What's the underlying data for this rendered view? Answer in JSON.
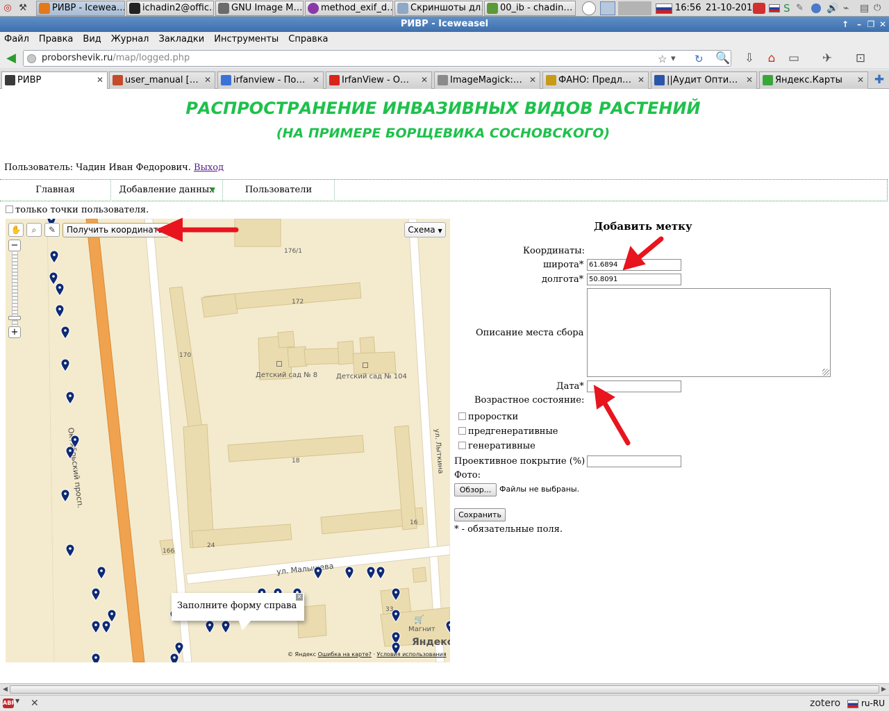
{
  "taskbar": {
    "tasks": [
      {
        "label": "РИВР - Icewea…",
        "active": true
      },
      {
        "label": "ichadin2@offic…"
      },
      {
        "label": "GNU Image M…"
      },
      {
        "label": "method_exif_d…"
      },
      {
        "label": "Скриншоты дл…"
      },
      {
        "label": "00_ib - chadin…"
      }
    ],
    "time": "16:56",
    "date": "21-10-2014"
  },
  "window": {
    "title": "РИВР - Iceweasel"
  },
  "menubar": {
    "items": [
      "Файл",
      "Правка",
      "Вид",
      "Журнал",
      "Закладки",
      "Инструменты",
      "Справка"
    ]
  },
  "navbar": {
    "url_host": "proborshevik.ru",
    "url_path": "/map/logged.php"
  },
  "tabs": [
    {
      "label": "РИВР",
      "active": true,
      "icon_color": "#3a3a3a"
    },
    {
      "label": "user_manual [Ин…",
      "icon_color": "#c44a2a"
    },
    {
      "label": "irfanview - Поиск…",
      "icon_color": "#3b72d9"
    },
    {
      "label": "IrfanView - Offici…",
      "icon_color": "#d8241a"
    },
    {
      "label": "ImageMagick: C…",
      "icon_color": "#8a8a8a"
    },
    {
      "label": "ФАНО: Предло…",
      "icon_color": "#c79a1a"
    },
    {
      "label": "||Аудит Оптима …",
      "icon_color": "#2a56a8"
    },
    {
      "label": "Яндекс.Карты",
      "icon_color": "#3aa63a"
    }
  ],
  "page": {
    "title_line1": "РАСПРОСТРАНЕНИЕ ИНВАЗИВНЫХ ВИДОВ РАСТЕНИЙ",
    "title_line2": "(НА ПРИМЕРЕ БОРЩЕВИКА СОСНОВСКОГО)",
    "user_prefix": "Пользователь: Чадин Иван Федорович.",
    "logout": "Выход",
    "nav": [
      "Главная",
      "Добавление данных",
      "Пользователи"
    ],
    "own_points_label": "только точки пользователя."
  },
  "map": {
    "get_coords_button": "Получить координаты",
    "scheme_button": "Схема",
    "hint": "Заполните форму справа",
    "street_oktyabrsky": "Октябрьский просп.",
    "street_malysheva": "ул. Малышева",
    "street_lytkina": "ул. Лыткина",
    "poi_kindergarten_8": "Детский сад № 8",
    "poi_kindergarten_104": "Детский сад № 104",
    "poi_magnit": "Магнит",
    "house_numbers": [
      "176/1",
      "172",
      "170",
      "18",
      "16",
      "24",
      "166",
      "33"
    ],
    "copyright": "© Яндекс",
    "error_link": "Ошибка на карте?",
    "terms_link": "Условия использования",
    "logo": "Яндекс"
  },
  "form": {
    "title": "Добавить метку",
    "coords_label": "Координаты:",
    "lat_label": "широта*",
    "lat_value": "61.6894",
    "lon_label": "долгота*",
    "lon_value": "50.8091",
    "desc_label": "Описание места сбора",
    "date_label": "Дата*",
    "age_label": "Возрастное состояние:",
    "age_options": [
      "проростки",
      "предгенеративные",
      "генеративные"
    ],
    "coverage_label": "Проективное покрытие (%)",
    "photo_label": "Фото:",
    "browse_button": "Обзор...",
    "file_status": "Файлы не выбраны.",
    "save_button": "Сохранить",
    "required_note": "* - обязательные поля."
  },
  "statusbar": {
    "zotero": "zotero",
    "lang": "ru-RU"
  },
  "colors": {
    "title_green": "#1ec14b",
    "marker": "#0f2a74",
    "arrow": "#e8141e"
  }
}
